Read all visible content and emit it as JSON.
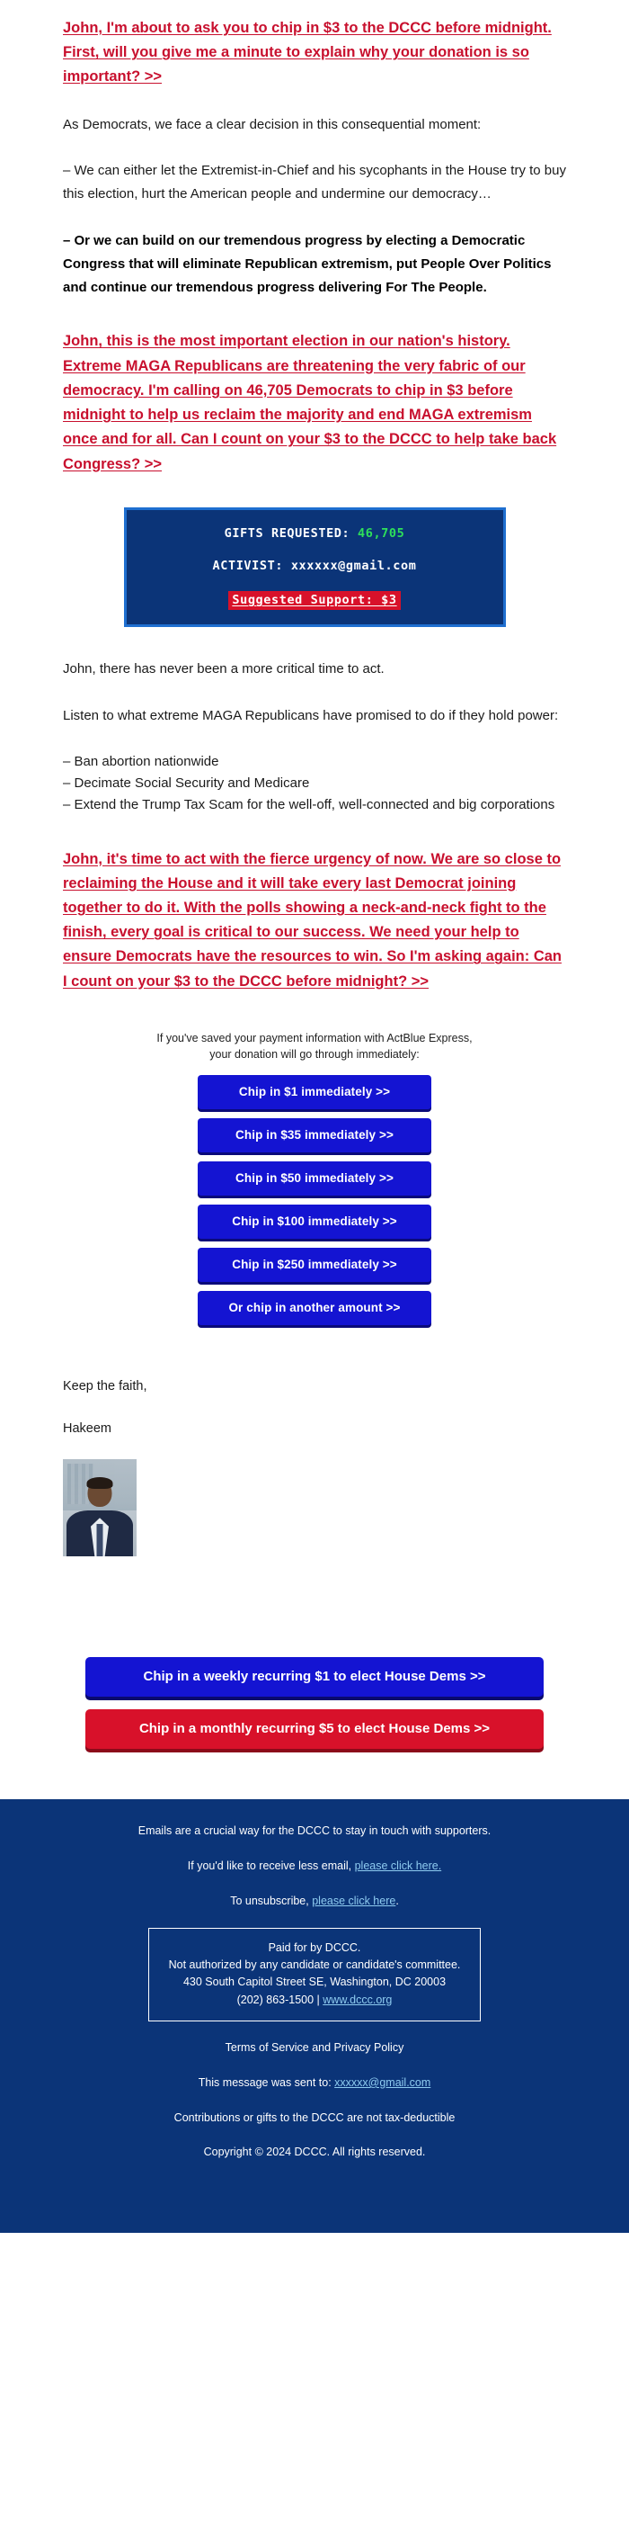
{
  "colors": {
    "red_link": "#c8102e",
    "navy": "#0b3478",
    "button_blue": "#1414d2",
    "button_red": "#d8112a",
    "green_count": "#2ee05a",
    "box_border_blue": "#1f6fd0",
    "footer_link": "#8ecbf0"
  },
  "intro": {
    "headline_link": "John, I'm about to ask you to chip in $3 to the DCCC before midnight. First, will you give me a minute to explain why your donation is so important? >>",
    "p1": "As Democrats, we face a clear decision in this consequential moment:",
    "p2": "– We can either let the Extremist-in-Chief and his sycophants in the House try to buy this election, hurt the American people and undermine our democracy…",
    "p3_bold": "– Or we can build on our tremendous progress by electing a Democratic Congress that will eliminate Republican extremism, put People Over Politics and continue our tremendous progress delivering For The People.",
    "ask_link": "John, this is the most important election in our nation's history. Extreme MAGA Republicans are threatening the very fabric of our democracy. I'm calling on 46,705 Democrats to chip in $3 before midnight to help us reclaim the majority and end MAGA extremism once and for all. Can I count on your $3 to the DCCC to help take back Congress? >>"
  },
  "stats_box": {
    "gifts_label": "GIFTS REQUESTED:",
    "gifts_value": "46,705",
    "activist_label": "ACTIVIST:",
    "activist_value": "xxxxxx@gmail.com",
    "suggested_support": "Suggested Support: $3"
  },
  "middle": {
    "p1": "John, there has never been a more critical time to act.",
    "p2": "Listen to what extreme MAGA Republicans have promised to do if they hold power:",
    "bullets": [
      "– Ban abortion nationwide",
      "– Decimate Social Security and Medicare",
      "– Extend the Trump Tax Scam for the well-off, well-connected and big corporations"
    ],
    "urgency_link": "John, it's time to act with the fierce urgency of now. We are so close to reclaiming the House and it will take every last Democrat joining together to do it. With the polls showing a neck-and-neck fight to the finish, every goal is critical to our success. We need your help to ensure Democrats have the resources to win. So I'm asking again: Can I count on your $3 to the DCCC before midnight? >>"
  },
  "donate": {
    "actblue_note_line1": "If you've saved your payment information with ActBlue Express,",
    "actblue_note_line2": "your donation will go through immediately:",
    "buttons": [
      "Chip in $1 immediately >>",
      "Chip in $35 immediately >>",
      "Chip in $50 immediately >>",
      "Chip in $100 immediately >>",
      "Chip in $250 immediately >>",
      "Or chip in another amount >>"
    ]
  },
  "signature": {
    "closing": "Keep the faith,",
    "name": "Hakeem",
    "photo_alt": "hakeem-jeffries-portrait"
  },
  "recurring": {
    "weekly": "Chip in a weekly recurring $1 to elect House Dems >>",
    "monthly": "Chip in a monthly recurring $5 to elect House Dems >>"
  },
  "footer": {
    "line1": "Emails are a crucial way for the DCCC to stay in touch with supporters.",
    "less_email_prefix": "If you'd like to receive less email, ",
    "less_email_link": "please click here.",
    "unsub_prefix": "To unsubscribe, ",
    "unsub_link": "please click here",
    "unsub_suffix": ".",
    "paid_line1": "Paid for by DCCC.",
    "paid_line2": "Not authorized by any candidate or candidate's committee.",
    "paid_line3": "430 South Capitol Street SE, Washington, DC 20003",
    "paid_phone": "(202) 863-1500 | ",
    "paid_website": "www.dccc.org",
    "terms": "Terms of Service and Privacy Policy",
    "sent_to_prefix": "This message was sent to: ",
    "sent_to_email": "xxxxxx@gmail.com",
    "tax": "Contributions or gifts to the DCCC are not tax-deductible",
    "copyright": "Copyright © 2024 DCCC. All rights reserved."
  }
}
